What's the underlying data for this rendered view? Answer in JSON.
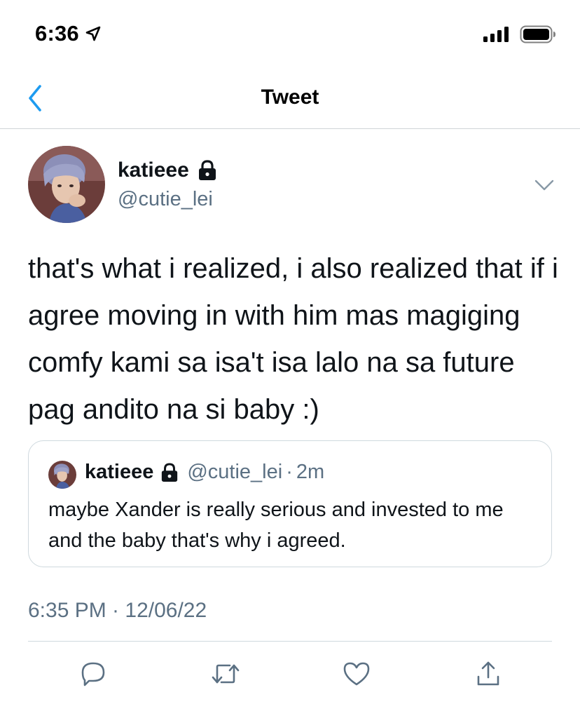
{
  "status_bar": {
    "time": "6:36"
  },
  "nav": {
    "title": "Tweet"
  },
  "tweet": {
    "display_name": "katieee",
    "handle": "@cutie_lei",
    "text": "that's what i realized, i also realized that if i agree moving in with him mas magiging comfy kami sa isa't isa lalo na sa future pag andito na si baby :)",
    "timestamp": "6:35 PM · 12/06/22"
  },
  "quoted_tweet": {
    "display_name": "katieee",
    "handle": "@cutie_lei",
    "separator": "·",
    "time": "2m",
    "text": "maybe Xander is really serious and invested to me and the baby that's why i agreed."
  },
  "colors": {
    "accent": "#1d9bf0",
    "secondary_text": "#5b7083",
    "border": "#cfd9de",
    "text": "#0f1419"
  },
  "icons": {
    "back": "chevron-left-icon",
    "lock": "lock-icon",
    "caret": "chevron-down-icon",
    "reply": "reply-icon",
    "retweet": "retweet-icon",
    "like": "heart-icon",
    "share": "share-icon",
    "signal": "signal-icon",
    "battery": "battery-icon",
    "location": "location-arrow-icon"
  }
}
